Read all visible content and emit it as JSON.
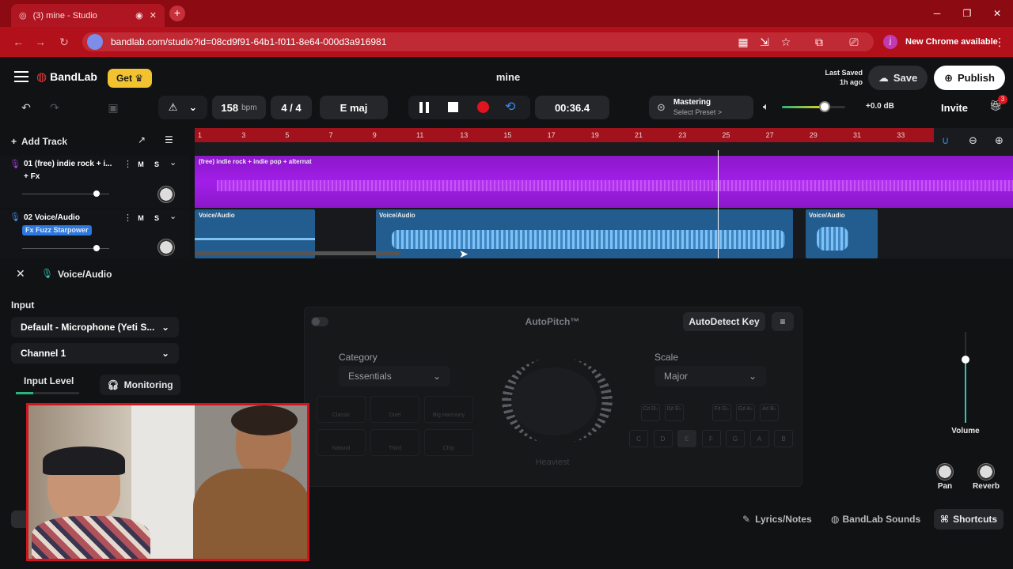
{
  "browser": {
    "tab_title": "(3) mine - Studio",
    "url": "bandlab.com/studio?id=08cd9f91-64b1-f011-8e64-000d3a916981",
    "profile_initial": "j",
    "new_chrome": "New Chrome available"
  },
  "header": {
    "logo": "BandLab",
    "get_label": "Get",
    "project_name": "mine",
    "last_saved_1": "Last Saved",
    "last_saved_2": "1h ago",
    "save_label": "Save",
    "publish_label": "Publish"
  },
  "toolbar": {
    "bpm_value": "158",
    "bpm_unit": "bpm",
    "time_sig": "4 / 4",
    "key": "E maj",
    "time": "00:36.4",
    "mastering_label": "Mastering",
    "mastering_sub": "Select Preset >",
    "volume_db": "+0.0 dB",
    "volume_level": 0.67,
    "invite_label": "Invite",
    "gift_badge": "3"
  },
  "tracks_panel": {
    "add_track": "Add Track",
    "ruler_ticks": [
      "1",
      "3",
      "5",
      "7",
      "9",
      "11",
      "13",
      "15",
      "17",
      "19",
      "21",
      "23",
      "25",
      "27",
      "29",
      "31",
      "33"
    ],
    "tracks": [
      {
        "name": "01  (free) indie rock + i...",
        "fx": "+ Fx",
        "mute": "M",
        "solo": "S",
        "volume": 0.85
      },
      {
        "name": "02  Voice/Audio",
        "fx": "Fx Fuzz Starpower",
        "mute": "M",
        "solo": "S",
        "volume": 0.85
      }
    ],
    "clips": {
      "track1": "(free) indie rock + indie pop + alternat",
      "voice1": "Voice/Audio",
      "voice2": "Voice/Audio",
      "voice3": "Voice/Audio"
    }
  },
  "editor": {
    "track_title": "Voice/Audio",
    "input_heading": "Input",
    "input_device": "Default - Microphone (Yeti S...",
    "channel": "Channel 1",
    "input_level": "Input Level",
    "monitoring": "Monitoring",
    "autopitch_title": "AutoPitch™",
    "autodetect": "AutoDetect Key",
    "category_label": "Category",
    "category_value": "Essentials",
    "scale_label": "Scale",
    "scale_value": "Major",
    "knob_label": "Heaviest",
    "presets": [
      "Classic",
      "Duet",
      "Big Harmony",
      "Natural",
      "Third",
      "Chip"
    ],
    "notes_top": [
      "C♯ D♭",
      "D♯ E♭",
      "F♯ G♭",
      "G♯ A♭",
      "A♯ B♭"
    ],
    "notes_bottom": [
      "C",
      "D",
      "E",
      "F",
      "G",
      "A",
      "B"
    ],
    "volume_label": "Volume",
    "pan_label": "Pan",
    "reverb_label": "Reverb"
  },
  "footer": {
    "lyrics": "Lyrics/Notes",
    "sounds": "BandLab Sounds",
    "shortcuts": "Shortcuts"
  },
  "colors": {
    "accent_red": "#b2101b",
    "purple_track": "#9b1de0",
    "voice_clip": "#2a6fa8",
    "get_yellow": "#f2c230"
  }
}
